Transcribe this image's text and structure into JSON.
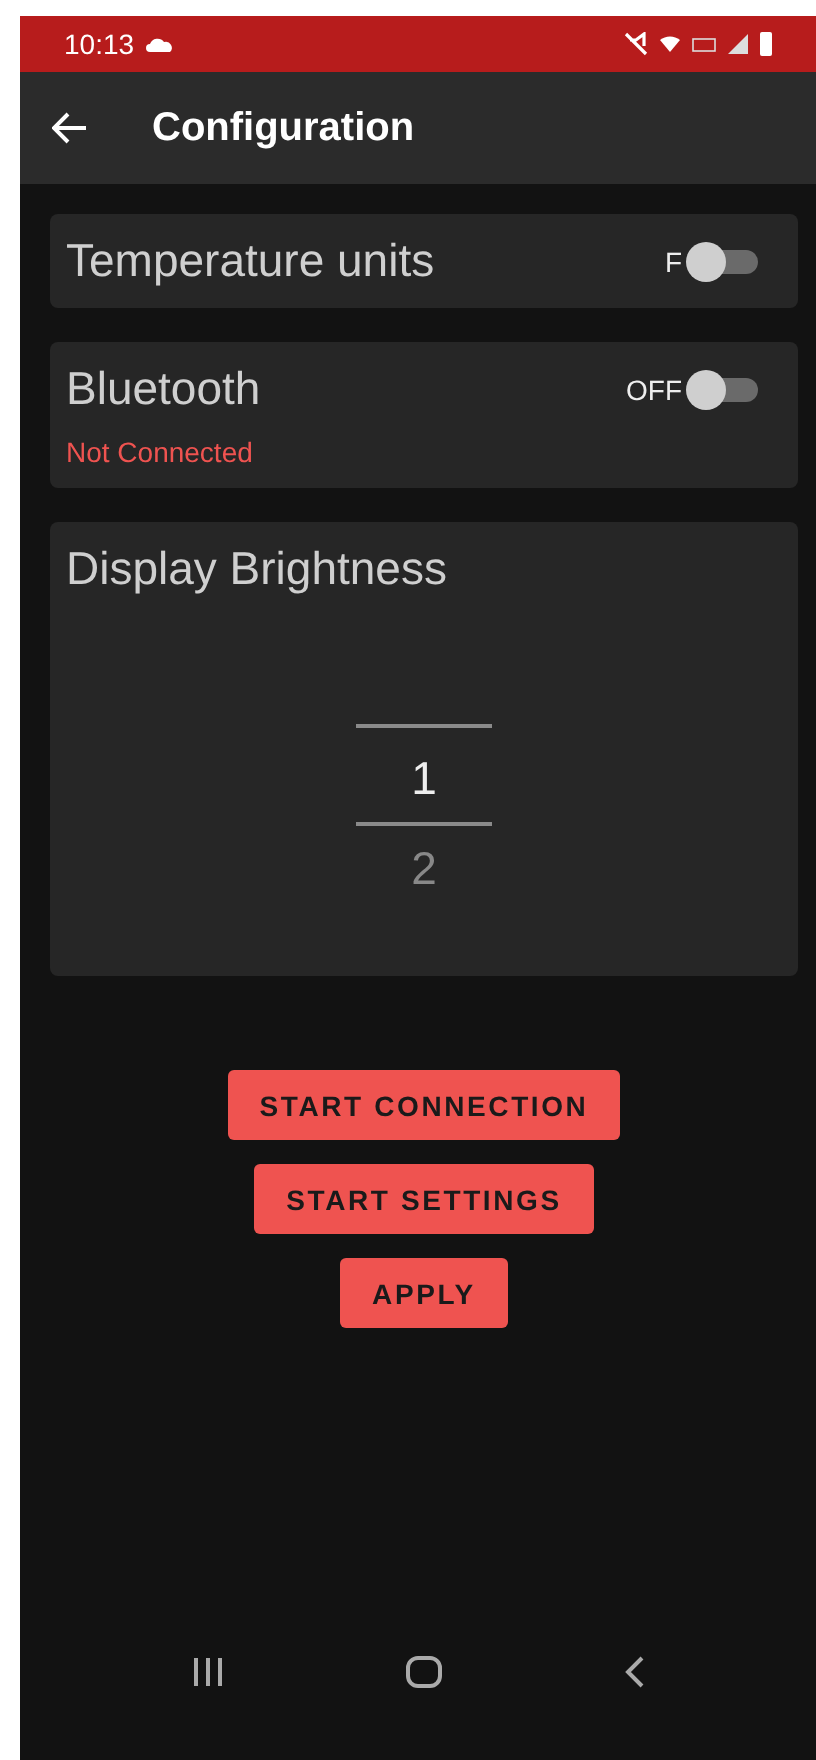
{
  "status_bar": {
    "time": "10:13"
  },
  "app_bar": {
    "title": "Configuration"
  },
  "settings": [
    {
      "kind": "toggle",
      "label": "Temperature units",
      "switch_label": "F",
      "on": false
    },
    {
      "kind": "toggle",
      "label": "Bluetooth",
      "switch_label": "OFF",
      "on": false,
      "status": "Not Connected"
    }
  ],
  "brightness": {
    "label": "Display Brightness",
    "values": [
      {
        "text": "1",
        "selected": true
      },
      {
        "text": "2",
        "selected": false
      }
    ]
  },
  "buttons": [
    "START CONNECTION",
    "START SETTINGS",
    "APPLY"
  ]
}
